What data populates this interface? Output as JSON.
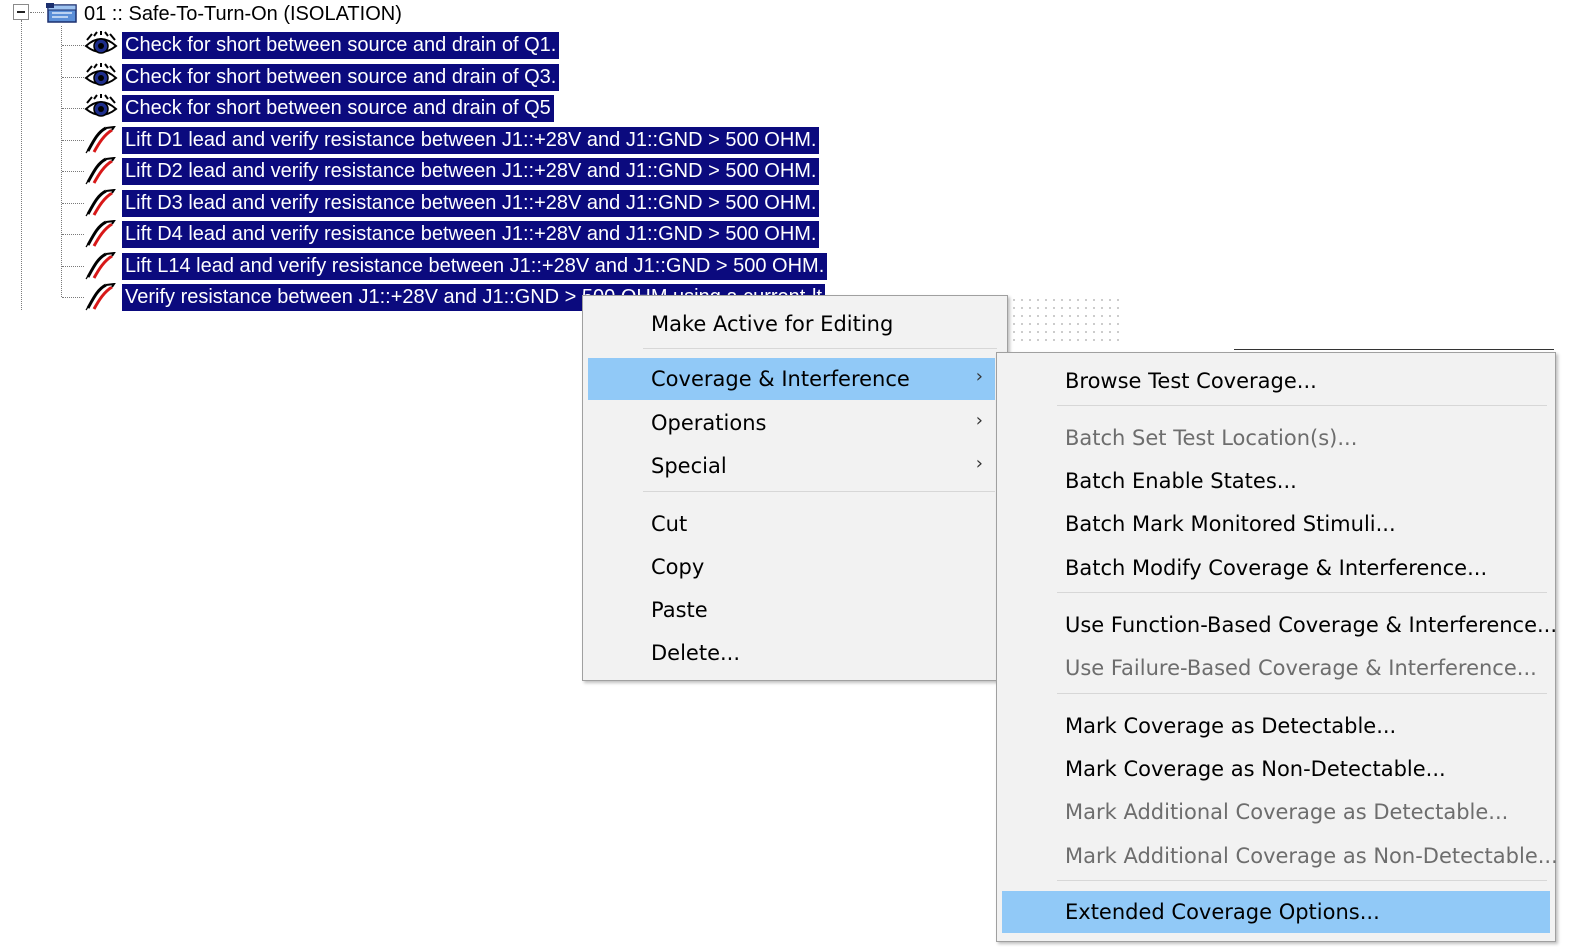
{
  "tree": {
    "root": {
      "label": "01 :: Safe-To-Turn-On (ISOLATION)",
      "icon": "test-group-icon",
      "expanded": true
    },
    "rows": [
      {
        "label": "Check for short between source and drain of Q1.",
        "icon": "inspect-eye-icon"
      },
      {
        "label": "Check for short between source and drain of Q3.",
        "icon": "inspect-eye-icon"
      },
      {
        "label": "Check for short between source and drain of Q5",
        "icon": "inspect-eye-icon"
      },
      {
        "label": "Lift D1 lead and verify resistance between J1::+28V and J1::GND > 500 OHM.",
        "icon": "probe-icon"
      },
      {
        "label": "Lift D2 lead and verify resistance between J1::+28V and J1::GND > 500 OHM.",
        "icon": "probe-icon"
      },
      {
        "label": "Lift D3 lead and verify resistance between J1::+28V and J1::GND > 500 OHM.",
        "icon": "probe-icon"
      },
      {
        "label": "Lift D4 lead and verify resistance between J1::+28V and J1::GND > 500 OHM.",
        "icon": "probe-icon"
      },
      {
        "label": "Lift L14 lead and verify resistance between J1::+28V and J1::GND > 500 OHM.",
        "icon": "probe-icon"
      },
      {
        "label": "Verify resistance between J1::+28V and J1::GND > 500 OHM using a current-lt",
        "icon": "probe-icon"
      }
    ]
  },
  "context_menu": {
    "items": [
      {
        "label": "Make Active for Editing"
      },
      {
        "label": "Coverage & Interference",
        "has_submenu": true,
        "highlighted": true
      },
      {
        "label": "Operations",
        "has_submenu": true
      },
      {
        "label": "Special",
        "has_submenu": true
      },
      {
        "label": "Cut"
      },
      {
        "label": "Copy"
      },
      {
        "label": "Paste"
      },
      {
        "label": "Delete..."
      }
    ],
    "submenu_arrow": "›"
  },
  "submenu": {
    "items": [
      {
        "label": "Browse Test Coverage...",
        "enabled": true
      },
      {
        "label": "Batch Set Test Location(s)...",
        "enabled": false
      },
      {
        "label": "Batch Enable States...",
        "enabled": true
      },
      {
        "label": "Batch Mark Monitored Stimuli...",
        "enabled": true
      },
      {
        "label": "Batch Modify Coverage & Interference...",
        "enabled": true
      },
      {
        "label": "Use Function-Based Coverage & Interference...",
        "enabled": true
      },
      {
        "label": "Use Failure-Based Coverage & Interference...",
        "enabled": false
      },
      {
        "label": "Mark Coverage as Detectable...",
        "enabled": true
      },
      {
        "label": "Mark Coverage as Non-Detectable...",
        "enabled": true
      },
      {
        "label": "Mark Additional Coverage as Detectable...",
        "enabled": false
      },
      {
        "label": "Mark Additional Coverage as Non-Detectable...",
        "enabled": false
      },
      {
        "label": "Extended Coverage Options...",
        "enabled": true,
        "highlighted": true
      }
    ]
  },
  "colors": {
    "selection": "#0b0a7e",
    "menu_highlight": "#91c9f7",
    "menu_background": "#f2f2f2",
    "disabled_text": "#6d6d6d"
  }
}
